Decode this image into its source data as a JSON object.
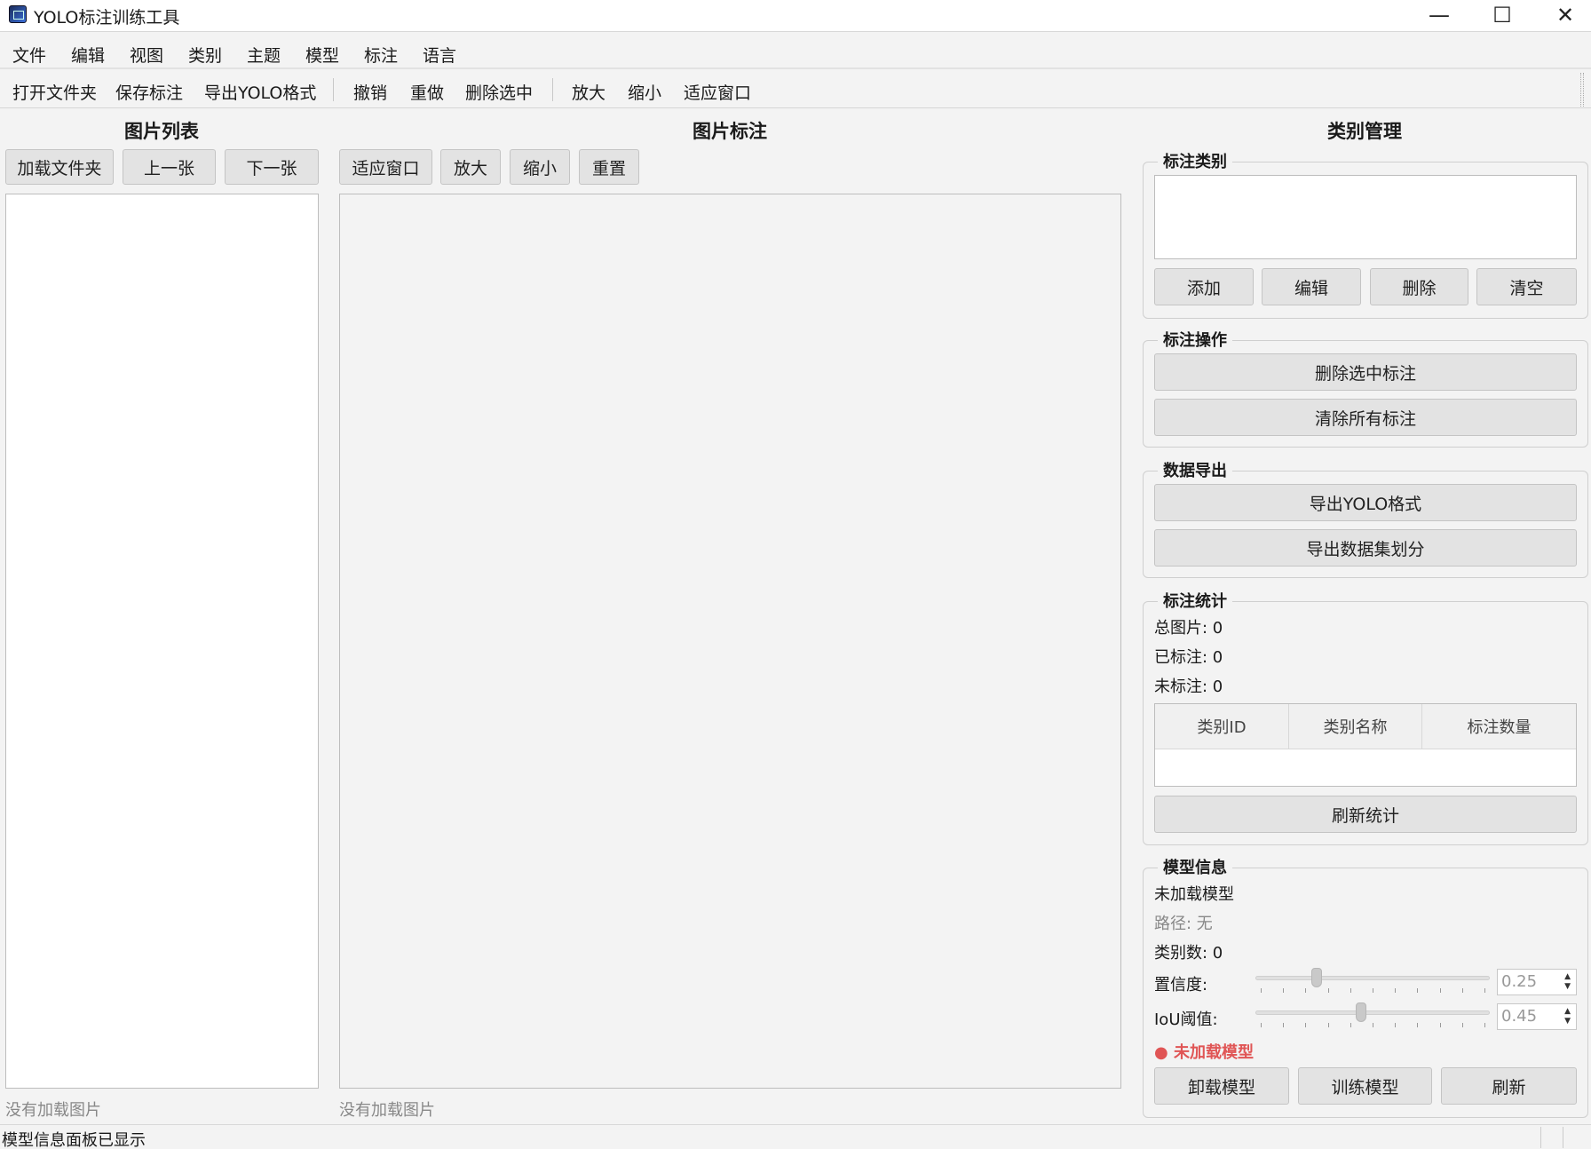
{
  "window": {
    "title": "YOLO标注训练工具",
    "minimize": "—",
    "maximize": "☐",
    "close": "✕"
  },
  "menu": [
    "文件",
    "编辑",
    "视图",
    "类别",
    "主题",
    "模型",
    "标注",
    "语言"
  ],
  "toolbar": {
    "open_folder": "打开文件夹",
    "save_annotation": "保存标注",
    "export_yolo": "导出YOLO格式",
    "undo": "撤销",
    "redo": "重做",
    "delete_selected": "删除选中",
    "zoom_in": "放大",
    "zoom_out": "缩小",
    "fit_window": "适应窗口"
  },
  "image_list": {
    "title": "图片列表",
    "load_folder": "加载文件夹",
    "prev": "上一张",
    "next": "下一张",
    "status": "没有加载图片"
  },
  "annotate": {
    "title": "图片标注",
    "fit_window": "适应窗口",
    "zoom_in": "放大",
    "zoom_out": "缩小",
    "reset": "重置",
    "status": "没有加载图片"
  },
  "class_mgmt": {
    "title": "类别管理",
    "classes_group": "标注类别",
    "add": "添加",
    "edit": "编辑",
    "delete": "删除",
    "clear": "清空",
    "ops_group": "标注操作",
    "delete_selected": "删除选中标注",
    "clear_all": "清除所有标注",
    "export_group": "数据导出",
    "export_yolo": "导出YOLO格式",
    "export_split": "导出数据集划分",
    "stats_group": "标注统计",
    "total": "总图片: 0",
    "labeled": "已标注: 0",
    "unlabeled": "未标注: 0",
    "table_headers": [
      "类别ID",
      "类别名称",
      "标注数量"
    ],
    "refresh_stats": "刷新统计",
    "model_group": "模型信息",
    "model_state": "未加载模型",
    "model_path": "路径: 无",
    "model_classes": "类别数: 0",
    "confidence_label": "置信度:",
    "confidence_value": "0.25",
    "confidence": 0.25,
    "iou_label": "IoU阈值:",
    "iou_value": "0.45",
    "iou": 0.45,
    "status_bullet": "● 未加载模型",
    "status_color": "#e05555",
    "unload": "卸载模型",
    "train": "训练模型",
    "refresh": "刷新"
  },
  "statusbar": {
    "message": "模型信息面板已显示"
  }
}
